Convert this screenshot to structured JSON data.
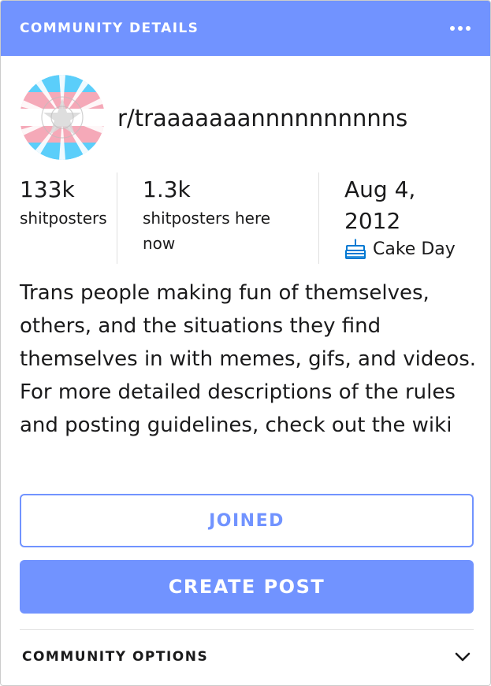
{
  "header": {
    "title": "COMMUNITY DETAILS",
    "menu_icon": "more-horizontal-icon"
  },
  "community": {
    "name": "r/traaaaaaannnnnnnnnns",
    "avatar_icon": "trans-flag-avatar-icon"
  },
  "stats": {
    "members_value": "133k",
    "members_label": "shitposters",
    "online_value": "1.3k",
    "online_label": "shitposters here now",
    "created_value": "Aug 4, 2012",
    "created_label": "Cake Day",
    "cake_icon": "cake-icon"
  },
  "description": "Trans people making fun of themselves, others, and the situations they find themselves in with memes, gifs, and videos. For more detailed descriptions of the rules and posting guidelines, check out the wiki",
  "buttons": {
    "joined_label": "JOINED",
    "create_post_label": "CREATE POST"
  },
  "options": {
    "label": "COMMUNITY OPTIONS",
    "chevron_icon": "chevron-down-icon"
  },
  "colors": {
    "accent": "#7193ff",
    "flag_blue": "#5bcefa",
    "flag_pink": "#f5a9b8",
    "cake_blue": "#0079d3"
  }
}
